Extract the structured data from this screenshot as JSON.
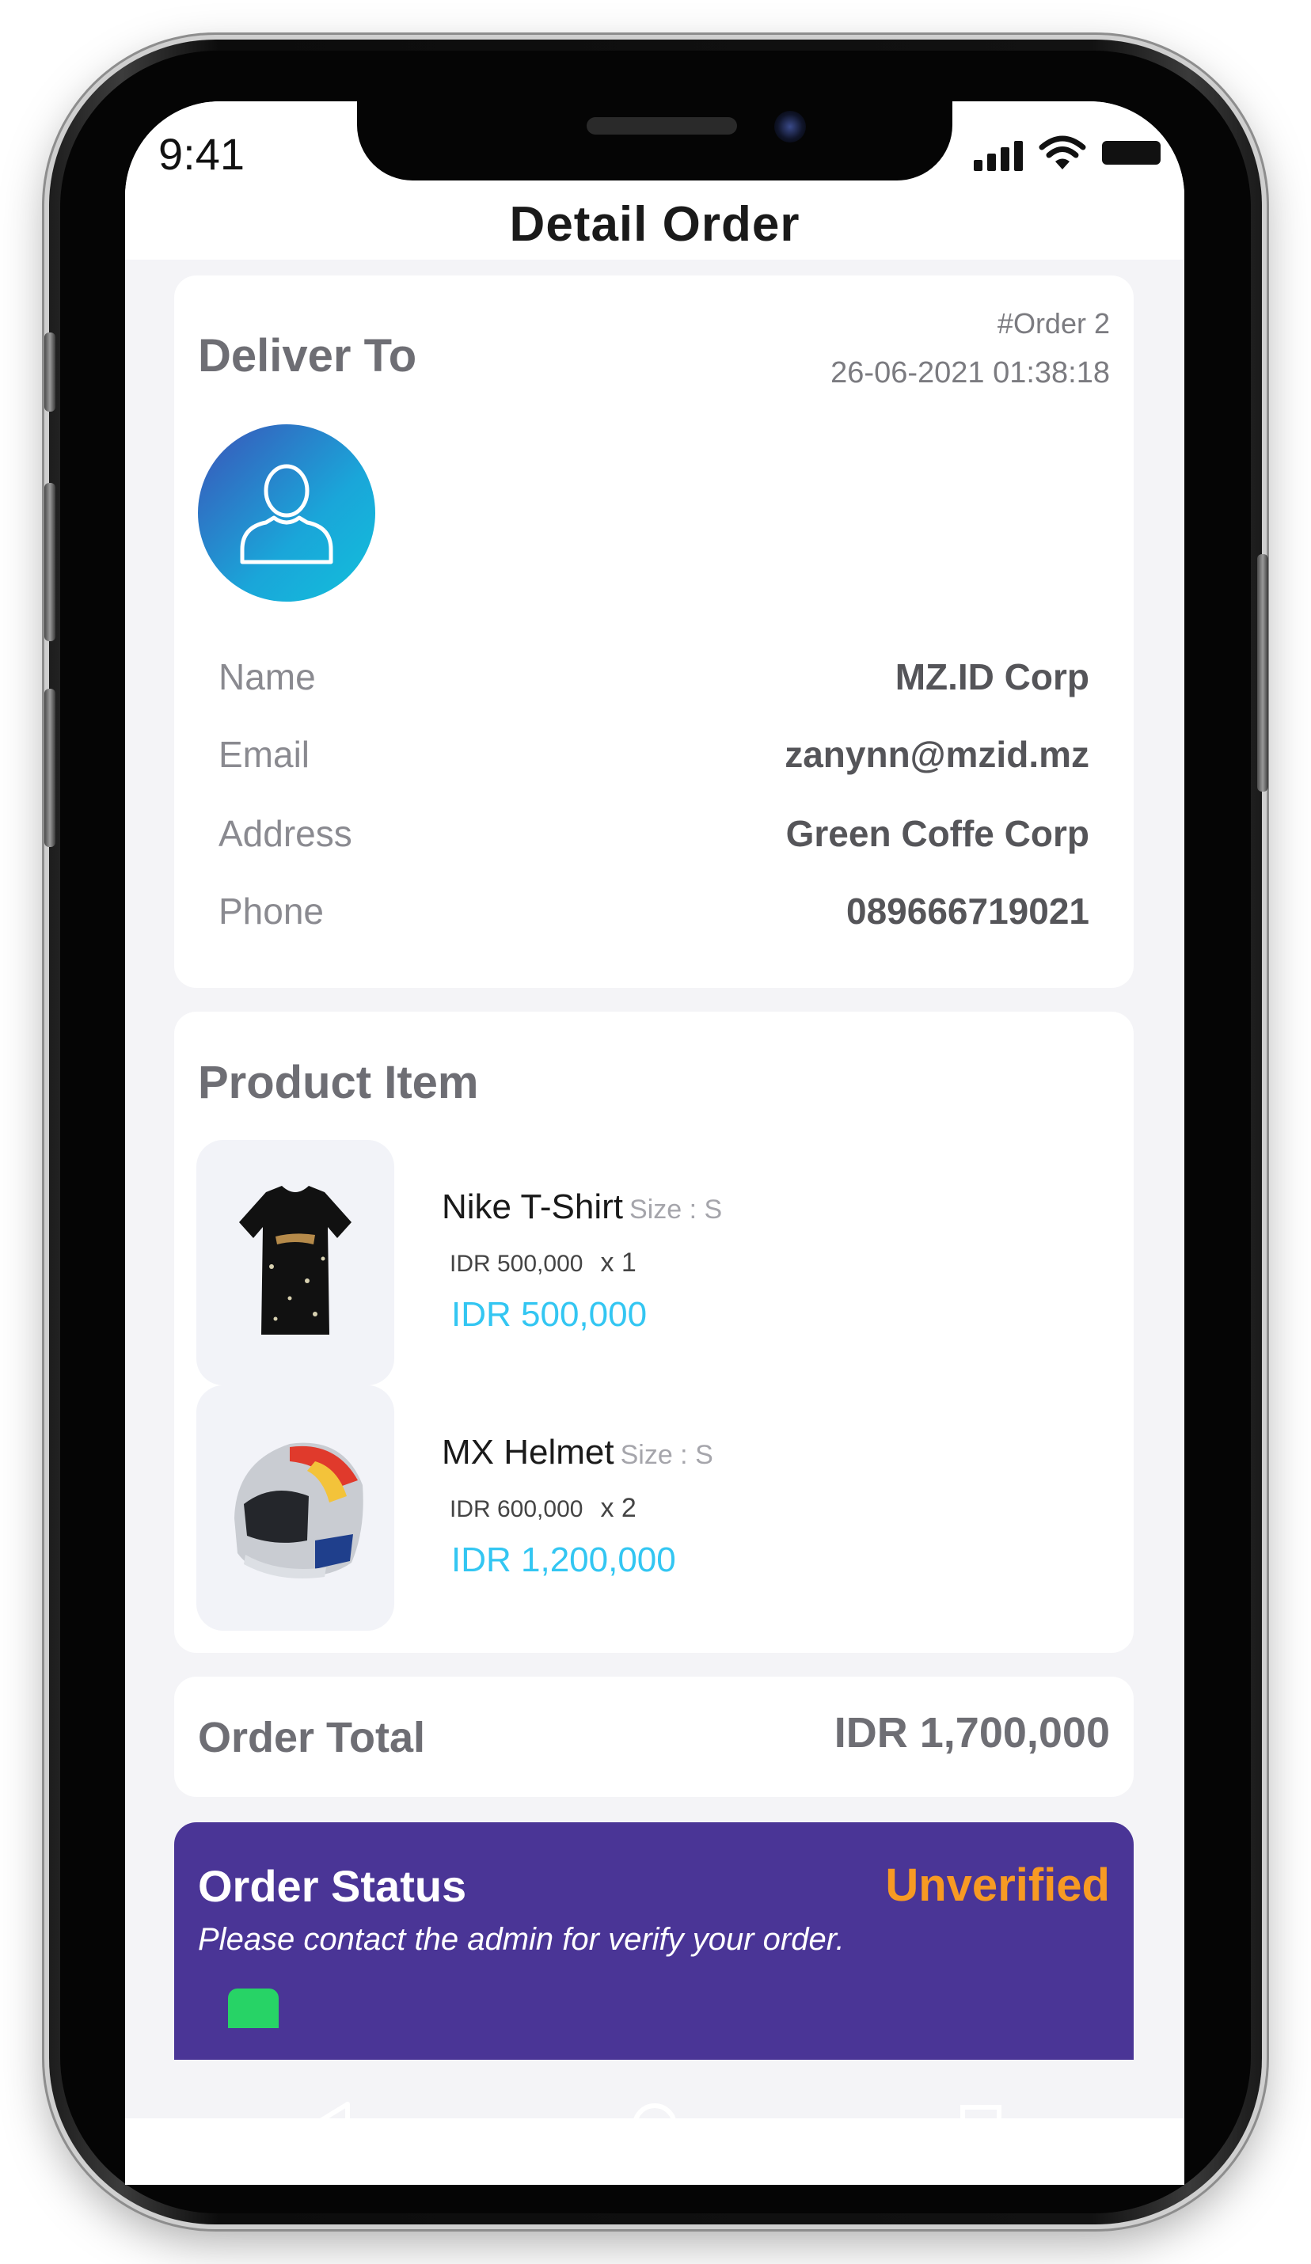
{
  "status_bar": {
    "time": "9:41"
  },
  "header": {
    "title": "Detail Order"
  },
  "deliver": {
    "title": "Deliver To",
    "order_number": "#Order 2",
    "order_date": "26-06-2021 01:38:18",
    "rows": [
      {
        "label": "Name",
        "value": "MZ.ID Corp"
      },
      {
        "label": "Email",
        "value": "zanynn@mzid.mz"
      },
      {
        "label": "Address",
        "value": "Green Coffe Corp"
      },
      {
        "label": "Phone",
        "value": "089666719021"
      }
    ]
  },
  "products": {
    "title": "Product Item",
    "items": [
      {
        "name": "Nike T-Shirt",
        "size": "Size : S",
        "unit_price": "IDR 500,000",
        "qty": "x 1",
        "total": "IDR 500,000",
        "image": "tshirt-image"
      },
      {
        "name": "MX Helmet",
        "size": "Size : S",
        "unit_price": "IDR 600,000",
        "qty": "x 2",
        "total": "IDR 1,200,000",
        "image": "helmet-image"
      }
    ]
  },
  "order_total": {
    "label": "Order Total",
    "value": "IDR 1,700,000"
  },
  "order_status": {
    "title": "Order Status",
    "status": "Unverified",
    "note": "Please contact the admin for verify your order."
  },
  "colors": {
    "accent_blue": "#33c6f2",
    "status_purple": "#4a3596",
    "status_orange": "#f79a23",
    "whatsapp_green": "#27d366"
  },
  "icons": [
    "user-avatar-icon",
    "whatsapp-icon",
    "back-icon",
    "home-icon",
    "recents-icon"
  ]
}
